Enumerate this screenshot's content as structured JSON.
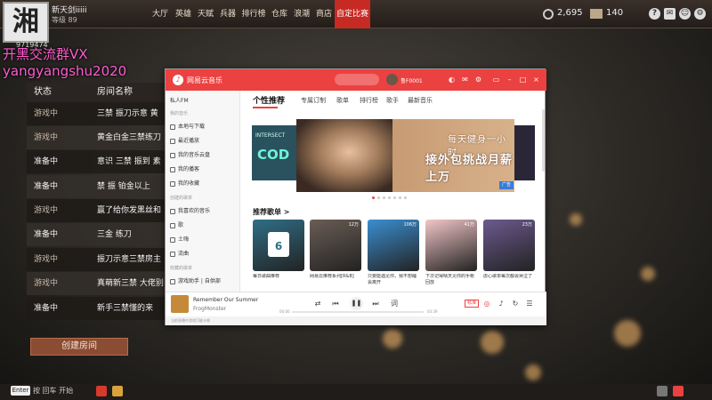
{
  "game": {
    "avatar_char": "湘",
    "username": "新天剑iiiii",
    "level": "等级 89",
    "room_no": "9719474",
    "nav": [
      "大厅",
      "英雄",
      "天赋",
      "兵器",
      "排行榜",
      "仓库",
      "浪潮",
      "商店",
      "自定比赛"
    ],
    "active_nav": 8,
    "coins": "2,695",
    "gems": "140",
    "icons": [
      "help-icon",
      "mail-icon",
      "friends-icon",
      "settings-icon"
    ]
  },
  "stream": {
    "line1": "开黑交流群VX",
    "line2": "yangyangshu2020"
  },
  "rooms": {
    "headers": [
      "状态",
      "房间名称"
    ],
    "rows": [
      {
        "status": "游戏中",
        "name": "三禁 振刀示意 黄"
      },
      {
        "status": "游戏中",
        "name": "黄金白金三禁练刀"
      },
      {
        "status": "准备中",
        "name": "意识 三禁 振到 素"
      },
      {
        "status": "准备中",
        "name": "禁 振 铂金以上"
      },
      {
        "status": "游戏中",
        "name": "赢了给你发黑丝和"
      },
      {
        "status": "准备中",
        "name": "三金 练刀"
      },
      {
        "status": "游戏中",
        "name": "振刀示意三禁房主"
      },
      {
        "status": "游戏中",
        "name": "真萌新三禁 大佬别"
      },
      {
        "status": "准备中",
        "name": "新手三禁懂的来"
      }
    ],
    "create_label": "创建房间"
  },
  "bottom": {
    "enter_key": "Enter",
    "hint": "按 回车 开始"
  },
  "music": {
    "app_title": "网易云音乐",
    "search_placeholder": "",
    "user": "鲁F0001",
    "sidebar": {
      "top_item": "私人FM",
      "group_mine": "我的音乐",
      "mine_items": [
        "本地与下载",
        "最近播放",
        "我的音乐云盘",
        "我的播客",
        "我的收藏"
      ],
      "group_created": "创建的歌单",
      "created_items": [
        "我喜欢的音乐",
        "歌",
        "土嗨",
        "流曲"
      ],
      "group_collected": "收藏的歌单",
      "collected_items": [
        "游戏助手 | 自供部"
      ]
    },
    "tabs": [
      "个性推荐",
      "专属订制",
      "歌单",
      "排行榜",
      "歌手",
      "最新音乐"
    ],
    "active_tab": 0,
    "banner": {
      "left_text": "INTERSECT",
      "left_big": "COD",
      "line1": "每天健身一小时",
      "line2": "接外包挑战月薪上万",
      "tag": "广告"
    },
    "rec_title": "推荐歌单 >",
    "playlists": [
      {
        "label": "每日歌曲推荐",
        "plays": "",
        "color": "#2f6f86"
      },
      {
        "label": "网易云推荐系列[R&B]",
        "plays": "12万",
        "color": "#6a5d55"
      },
      {
        "label": "只要能遇见你，我不想睡会离开",
        "plays": "106万",
        "color": "#3a8fd1"
      },
      {
        "label": "下次记得晴天见你的手帐回放",
        "plays": "41万",
        "color": "#f3c6c7"
      },
      {
        "label": "虐心歌单每次都会哭泣了",
        "plays": "23万",
        "color": "#6c5a8e"
      }
    ],
    "player": {
      "song": "Remember Our Summer",
      "artist": "FrogMonster",
      "time_current": "00:00",
      "time_total": "03:39",
      "progress": 0.0,
      "quality": "标准"
    },
    "status": "当前直播中游戏可能卡顿"
  }
}
